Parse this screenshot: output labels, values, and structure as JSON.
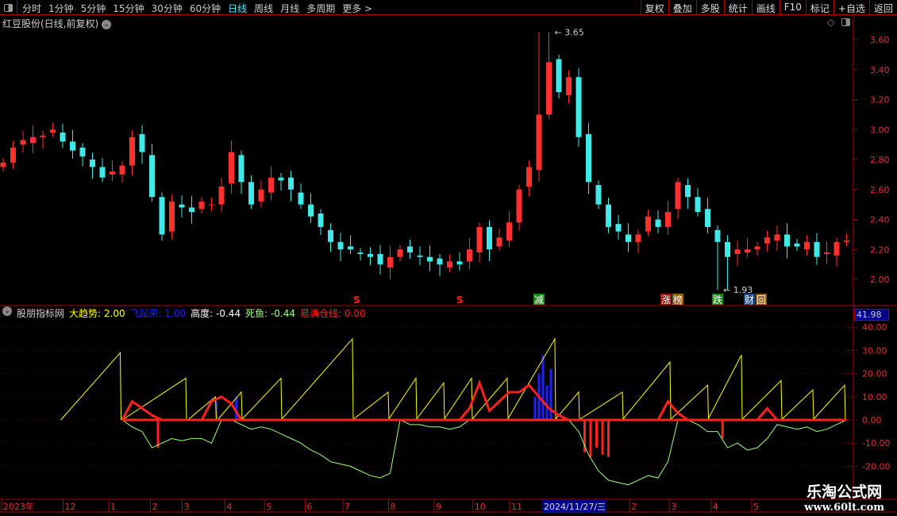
{
  "toolbar": {
    "periods": [
      "分时",
      "1分钟",
      "5分钟",
      "15分钟",
      "30分钟",
      "60分钟",
      "日线",
      "周线",
      "月线",
      "多周期",
      "更多 >"
    ],
    "active": "日线",
    "right_buttons": [
      "复权",
      "叠加",
      "多股",
      "统计",
      "画线",
      "F10",
      "标记",
      "+自选",
      "返回"
    ]
  },
  "title": "红豆股份(日线,前复权)",
  "indicator": {
    "name": "股朋指标网",
    "values": [
      {
        "label": "大趋势: 2.00",
        "color": "#ffff00"
      },
      {
        "label": "飞起来: 1.00",
        "color": "#2020ff"
      },
      {
        "label": "高度: -0.44",
        "color": "#ffffff"
      },
      {
        "label": "死鱼: -0.44",
        "color": "#a0ff80"
      },
      {
        "label": "易满仓线: 0.00",
        "color": "#ff2020"
      }
    ],
    "current": "41.98"
  },
  "signals": [
    {
      "text": "S",
      "idx": 35.6,
      "color": "#ff2020"
    },
    {
      "text": "S",
      "idx": 46,
      "color": "#ff2020"
    },
    {
      "text": "减",
      "idx": 54,
      "color": "#1a8a1a"
    },
    {
      "text": "涨",
      "idx": 66.8,
      "color": "#a01010"
    },
    {
      "text": "榜",
      "idx": 68,
      "color": "#9a5a10"
    },
    {
      "text": "跌",
      "idx": 72,
      "color": "#1a8a1a"
    },
    {
      "text": "财",
      "idx": 75.2,
      "color": "#1a4a8a"
    },
    {
      "text": "回",
      "idx": 76.4,
      "color": "#9a5a10"
    }
  ],
  "date_axis": [
    {
      "t": "2023年",
      "idx": 0
    },
    {
      "t": "12",
      "idx": 6.2
    },
    {
      "t": "1",
      "idx": 10.8
    },
    {
      "t": "2",
      "idx": 15
    },
    {
      "t": "3",
      "idx": 18.2
    },
    {
      "t": "4",
      "idx": 22.5
    },
    {
      "t": "5",
      "idx": 26.5
    },
    {
      "t": "6",
      "idx": 30.6
    },
    {
      "t": "7",
      "idx": 34.4
    },
    {
      "t": "8",
      "idx": 39
    },
    {
      "t": "9",
      "idx": 43.6
    },
    {
      "t": "10",
      "idx": 47.5
    },
    {
      "t": "11",
      "idx": 51.2
    },
    {
      "t": "2",
      "idx": 63.3
    },
    {
      "t": "3",
      "idx": 67.3
    },
    {
      "t": "4",
      "idx": 71.5
    },
    {
      "t": "5",
      "idx": 75.6
    }
  ],
  "date_cursor": "2024/11/27/三",
  "watermark": {
    "line1": "乐淘公式网",
    "line2": "www.60lt.com"
  },
  "chart_data": [
    {
      "type": "candlestick",
      "title": "红豆股份(日线,前复权)",
      "ylim": [
        1.9,
        3.7
      ],
      "yticks": [
        2.0,
        2.2,
        2.4,
        2.6,
        2.8,
        3.0,
        3.2,
        3.4,
        3.6
      ],
      "high_label": "3.65",
      "high_idx": 54.6,
      "high": 3.65,
      "low_label": "1.93",
      "low_idx": 72.4,
      "low": 1.93,
      "closes": [
        2.78,
        2.88,
        2.93,
        2.95,
        2.96,
        3.0,
        2.92,
        2.86,
        2.82,
        2.75,
        2.68,
        2.72,
        2.76,
        2.95,
        2.85,
        2.55,
        2.3,
        2.52,
        2.48,
        2.45,
        2.52,
        2.5,
        2.62,
        2.85,
        2.65,
        2.5,
        2.6,
        2.68,
        2.66,
        2.6,
        2.5,
        2.42,
        2.35,
        2.25,
        2.2,
        2.2,
        2.17,
        2.15,
        2.1,
        2.15,
        2.2,
        2.18,
        2.15,
        2.12,
        2.1,
        2.12,
        2.1,
        2.2,
        2.35,
        2.2,
        2.28,
        2.38,
        2.6,
        2.75,
        3.1,
        3.45,
        3.25,
        3.35,
        2.95,
        2.65,
        2.5,
        2.35,
        2.32,
        2.25,
        2.3,
        2.42,
        2.35,
        2.45,
        2.65,
        2.55,
        2.45,
        2.35,
        2.25,
        2.15,
        2.2,
        2.2,
        2.22,
        2.28,
        2.3,
        2.22,
        2.22,
        2.25,
        2.15,
        2.18,
        2.25,
        2.26
      ]
    },
    {
      "type": "line",
      "title": "股朋指标网",
      "ylim": [
        -25,
        45
      ],
      "yticks": [
        40,
        30,
        20,
        10,
        0,
        -10,
        -20
      ],
      "trend_ramps": [
        [
          5.8,
          11.8,
          29
        ],
        [
          12,
          18.4,
          18
        ],
        [
          18.6,
          21.4,
          10
        ],
        [
          21.6,
          24,
          12
        ],
        [
          24,
          28,
          18
        ],
        [
          28,
          35.2,
          35
        ],
        [
          35.2,
          38.8,
          12
        ],
        [
          38.8,
          41.6,
          18
        ],
        [
          41.6,
          44.4,
          16
        ],
        [
          44.4,
          47.2,
          18
        ],
        [
          47.2,
          50.8,
          18
        ],
        [
          50.8,
          55.6,
          35
        ],
        [
          55.6,
          58,
          12
        ],
        [
          58,
          62.4,
          12
        ],
        [
          62.4,
          67.2,
          25
        ],
        [
          67.2,
          71,
          15
        ],
        [
          71,
          74.4,
          28
        ],
        [
          74.4,
          78.4,
          17
        ],
        [
          78.4,
          81.6,
          13
        ],
        [
          81.6,
          84.8,
          15
        ]
      ],
      "dead_fish": [
        0,
        0,
        0,
        0,
        0,
        0,
        0,
        0,
        0,
        0,
        0,
        0,
        0,
        -3,
        -5,
        -12,
        -10,
        -8,
        -9,
        -8,
        -8,
        -10,
        0,
        0,
        -2,
        -4,
        -3,
        -4,
        -6,
        -8,
        -10,
        -13,
        -15,
        -18,
        -19,
        -20,
        -22,
        -24,
        -25,
        -23,
        0,
        -2,
        -2,
        -3,
        -3,
        -4,
        -3,
        0,
        0,
        0,
        0,
        0,
        0,
        0,
        0,
        0,
        0,
        0,
        -5,
        -15,
        -22,
        -26,
        -27,
        -28,
        -26,
        -24,
        -25,
        -18,
        0,
        0,
        -2,
        -5,
        -5,
        -12,
        -10,
        -13,
        -12,
        -8,
        -2,
        -3,
        -4,
        -3,
        -5,
        -4,
        -2,
        0
      ],
      "full_position": [
        null,
        null,
        null,
        null,
        null,
        null,
        null,
        null,
        null,
        null,
        null,
        null,
        0,
        8,
        5,
        2,
        0,
        0,
        0,
        0,
        0,
        8,
        10,
        7,
        0,
        0,
        0,
        0,
        0,
        0,
        0,
        0,
        0,
        0,
        0,
        0,
        0,
        0,
        0,
        0,
        0,
        0,
        0,
        0,
        0,
        0,
        0,
        5,
        16,
        4,
        8,
        12,
        12,
        15,
        10,
        5,
        2,
        0,
        0,
        0,
        0,
        0,
        0,
        0,
        0,
        0,
        0,
        8,
        3,
        0,
        0,
        0,
        0,
        0,
        0,
        0,
        0,
        5,
        0,
        0,
        0,
        0,
        0,
        0,
        0,
        0
      ],
      "red_bars": [
        [
          15.6,
          -12
        ],
        [
          58.6,
          -14
        ],
        [
          59.2,
          -16
        ],
        [
          59.8,
          -12
        ],
        [
          60.4,
          -15
        ],
        [
          61,
          -16
        ],
        [
          72.5,
          -8
        ]
      ],
      "blue_bars": [
        [
          53.6,
          10
        ],
        [
          54,
          20
        ],
        [
          54.4,
          28
        ],
        [
          54.8,
          15
        ],
        [
          55.2,
          22
        ],
        [
          21.5,
          8
        ],
        [
          23.5,
          10
        ]
      ]
    }
  ]
}
